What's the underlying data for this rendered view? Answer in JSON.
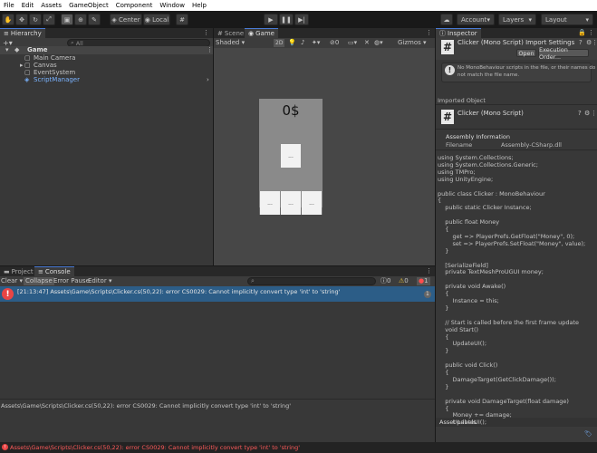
{
  "menu": [
    "File",
    "Edit",
    "Assets",
    "GameObject",
    "Component",
    "Window",
    "Help"
  ],
  "toolbar": {
    "pivot_label": "Center",
    "space_label": "Local",
    "account_label": "Account",
    "layers_label": "Layers",
    "layout_label": "Layout"
  },
  "hierarchy": {
    "tab_label": "Hierarchy",
    "search_placeholder": "All",
    "scene_name": "Game",
    "items": [
      "Main Camera",
      "Canvas",
      "EventSystem",
      "ScriptManager"
    ]
  },
  "scene": {
    "scene_tab": "Scene",
    "game_tab": "Game",
    "shading_label": "Shaded",
    "mode_2d_label": "2D",
    "gizmos_label": "Gizmos",
    "money_text": "0$",
    "center_button_text": "...",
    "bottom_buttons": [
      "...",
      "...",
      "..."
    ]
  },
  "bottom": {
    "project_tab": "Project",
    "console_tab": "Console",
    "clear_label": "Clear",
    "collapse_label": "Collapse",
    "error_pause_label": "Error Pause",
    "editor_label": "Editor",
    "count_info": "0",
    "count_warn": "0",
    "count_error": "1",
    "log_message": "[21:13:47] Assets\\Game\\Scripts\\Clicker.cs(50,22): error CS0029: Cannot implicitly convert type 'int' to 'string'",
    "log_count": "1",
    "detail_message": "Assets\\Game\\Scripts\\Clicker.cs(50,22): error CS0029: Cannot implicitly convert type 'int' to 'string'"
  },
  "status": {
    "message": "Assets\\Game\\Scripts\\Clicker.cs(50,22): error CS0029: Cannot implicitly convert type 'int' to 'string'"
  },
  "inspector": {
    "tab_label": "Inspector",
    "title": "Clicker (Mono Script) Import Settings",
    "open_label": "Open",
    "exec_order_label": "Execution Order...",
    "warning_line1": "No MonoBehaviour scripts in the file, or their names do",
    "warning_line2": "not match the file name.",
    "imported_object_label": "Imported Object",
    "object_title": "Clicker (Mono Script)",
    "assembly_header": "Assembly Information",
    "filename_label": "Filename",
    "filename_value": "Assembly-CSharp.dll",
    "code_lines": [
      "using System.Collections;",
      "using System.Collections.Generic;",
      "using TMPro;",
      "using UnityEngine;",
      "",
      "public class Clicker : MonoBehaviour",
      "{",
      "    public static Clicker Instance;",
      "",
      "    public float Money",
      "    {",
      "        get => PlayerPrefs.GetFloat(\"Money\", 0);",
      "        set => PlayerPrefs.SetFloat(\"Money\", value);",
      "    }",
      "",
      "    [SerializeField]",
      "    private TextMeshProUGUI money;",
      "",
      "    private void Awake()",
      "    {",
      "        Instance = this;",
      "    }",
      "",
      "    // Start is called before the first frame update",
      "    void Start()",
      "    {",
      "        UpdateUI();",
      "    }",
      "",
      "    public void Click()",
      "    {",
      "        DamageTarget(GetClickDamage());",
      "    }",
      "",
      "    private void DamageTarget(float damage)",
      "    {",
      "        Money += damage;",
      "        UpdateUI();"
    ],
    "asset_labels": "Asset Labels"
  }
}
